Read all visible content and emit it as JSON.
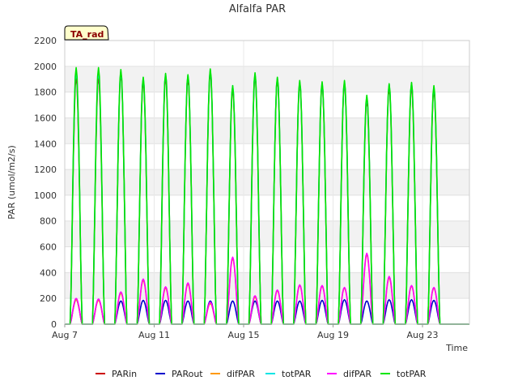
{
  "chart_data": {
    "type": "line",
    "title": "Alfalfa PAR",
    "xlabel": "Time",
    "ylabel": "PAR (umol/m2/s)",
    "badge": "TA_rad",
    "ylim": [
      0,
      2200
    ],
    "yticks": [
      0,
      200,
      400,
      600,
      800,
      1000,
      1200,
      1400,
      1600,
      1800,
      2000,
      2200
    ],
    "xlim_day": [
      7,
      25.1
    ],
    "xticks": [
      {
        "day": 7,
        "label": "Aug 7"
      },
      {
        "day": 11,
        "label": "Aug 11"
      },
      {
        "day": 15,
        "label": "Aug 15"
      },
      {
        "day": 19,
        "label": "Aug 19"
      },
      {
        "day": 23,
        "label": "Aug 23"
      }
    ],
    "grid": true,
    "legend_position": "bottom",
    "daily_peaks": {
      "days": [
        "Aug 7",
        "Aug 8",
        "Aug 9",
        "Aug 10",
        "Aug 11",
        "Aug 12",
        "Aug 13",
        "Aug 14",
        "Aug 15",
        "Aug 16",
        "Aug 17",
        "Aug 18",
        "Aug 19",
        "Aug 20",
        "Aug 21",
        "Aug 22",
        "Aug 23",
        "Aug 24"
      ],
      "day_numbers": [
        7,
        8,
        9,
        10,
        11,
        12,
        13,
        14,
        15,
        16,
        17,
        18,
        19,
        20,
        21,
        22,
        23,
        24
      ],
      "PARin": [
        1920,
        1920,
        1950,
        1890,
        1920,
        1910,
        1960,
        1830,
        1930,
        1900,
        1870,
        1860,
        1870,
        1740,
        1840,
        1850,
        1820,
        0
      ],
      "PARout": [
        190,
        190,
        180,
        185,
        185,
        180,
        180,
        180,
        180,
        180,
        180,
        185,
        190,
        180,
        190,
        190,
        185,
        0
      ],
      "difPAR_a": [
        190,
        185,
        240,
        340,
        280,
        310,
        160,
        510,
        210,
        260,
        300,
        295,
        280,
        540,
        360,
        295,
        280,
        0
      ],
      "totPAR_a": [
        1960,
        1960,
        1960,
        1910,
        1940,
        1930,
        1970,
        1850,
        1940,
        1910,
        1880,
        1870,
        1880,
        1760,
        1860,
        1870,
        1840,
        0
      ],
      "difPAR_b": [
        200,
        195,
        250,
        350,
        290,
        320,
        170,
        520,
        220,
        265,
        305,
        300,
        285,
        550,
        370,
        300,
        285,
        0
      ],
      "totPAR_b": [
        1990,
        1990,
        1975,
        1915,
        1945,
        1935,
        1980,
        1850,
        1950,
        1915,
        1890,
        1880,
        1890,
        1775,
        1865,
        1875,
        1850,
        0
      ]
    },
    "series": [
      {
        "name": "PARin",
        "key": "PARin",
        "color": "#cc0000"
      },
      {
        "name": "PARout",
        "key": "PARout",
        "color": "#0000cc"
      },
      {
        "name": "difPAR",
        "key": "difPAR_a",
        "color": "#ff9900"
      },
      {
        "name": "totPAR",
        "key": "totPAR_a",
        "color": "#00e5e5"
      },
      {
        "name": "difPAR",
        "key": "difPAR_b",
        "color": "#ff00ff"
      },
      {
        "name": "totPAR",
        "key": "totPAR_b",
        "color": "#00e600"
      }
    ]
  }
}
